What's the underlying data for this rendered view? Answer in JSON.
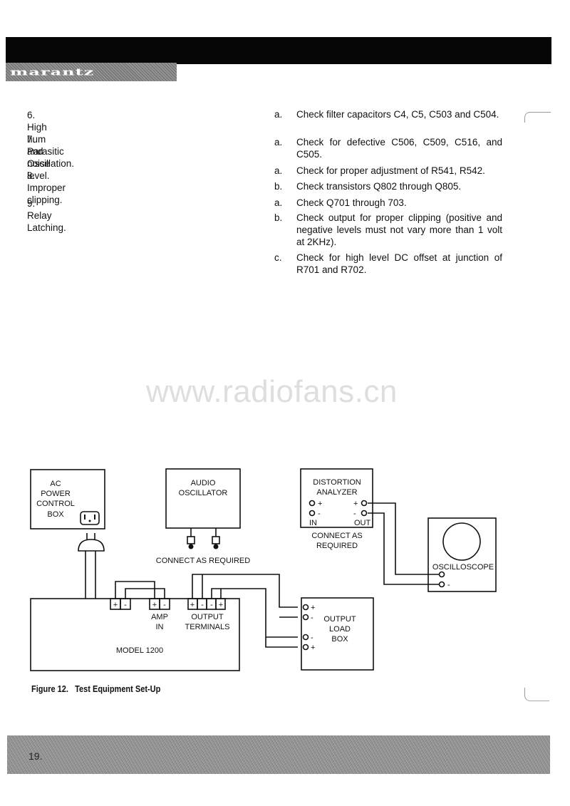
{
  "header": {
    "brand": "marantz"
  },
  "troubleshooting": {
    "items": [
      {
        "number": "6.",
        "symptom": "High hum and noise level.",
        "remedies": [
          {
            "letter": "a.",
            "text": "Check filter capacitors C4, C5, C503 and C504."
          }
        ]
      },
      {
        "number": "7.",
        "symptom": "Parasitic Oscillation.",
        "remedies": [
          {
            "letter": "a.",
            "text": "Check for defective C506, C509, C516, and C505."
          }
        ]
      },
      {
        "number": "8.",
        "symptom": "Improper clipping.",
        "remedies": [
          {
            "letter": "a.",
            "text": "Check for proper adjustment of R541, R542."
          },
          {
            "letter": "b.",
            "text": "Check transistors Q802 through Q805."
          }
        ]
      },
      {
        "number": "9.",
        "symptom": "Relay Latching.",
        "remedies": [
          {
            "letter": "a.",
            "text": "Check Q701 through 703."
          },
          {
            "letter": "b.",
            "text": "Check output for proper clipping (positive and negative levels must not vary more than 1 volt at 2KHz)."
          },
          {
            "letter": "c.",
            "text": "Check for high level DC offset at junction of R701 and R702."
          }
        ]
      }
    ]
  },
  "watermark": "www.radiofans.cn",
  "diagram": {
    "ac_power_box": [
      "AC",
      "POWER",
      "CONTROL",
      "BOX"
    ],
    "audio_oscillator": [
      "AUDIO",
      "OSCILLATOR"
    ],
    "connect_as_required_1": "CONNECT AS REQUIRED",
    "distortion_analyzer": [
      "DISTORTION",
      "ANALYZER"
    ],
    "analyzer_in_plus": "+",
    "analyzer_in_minus": "-",
    "analyzer_out_plus": "+",
    "analyzer_out_minus": "-",
    "analyzer_in_label": "IN",
    "analyzer_out_label": "OUT",
    "connect_as_required_2": [
      "CONNECT AS",
      "REQUIRED"
    ],
    "oscilloscope": "OSCILLOSCOPE",
    "scope_minus": "-",
    "model": "MODEL 1200",
    "terminal_plus": "+",
    "terminal_minus": "-",
    "amp_in": [
      "AMP",
      "IN"
    ],
    "output_terminals": [
      "OUTPUT",
      "TERMINALS"
    ],
    "output_load_box": [
      "OUTPUT",
      "LOAD",
      "BOX"
    ],
    "load_plus": "+",
    "load_minus": "-"
  },
  "caption": "Figure 12.   Test Equipment Set-Up",
  "footer": {
    "page_number": "19."
  }
}
